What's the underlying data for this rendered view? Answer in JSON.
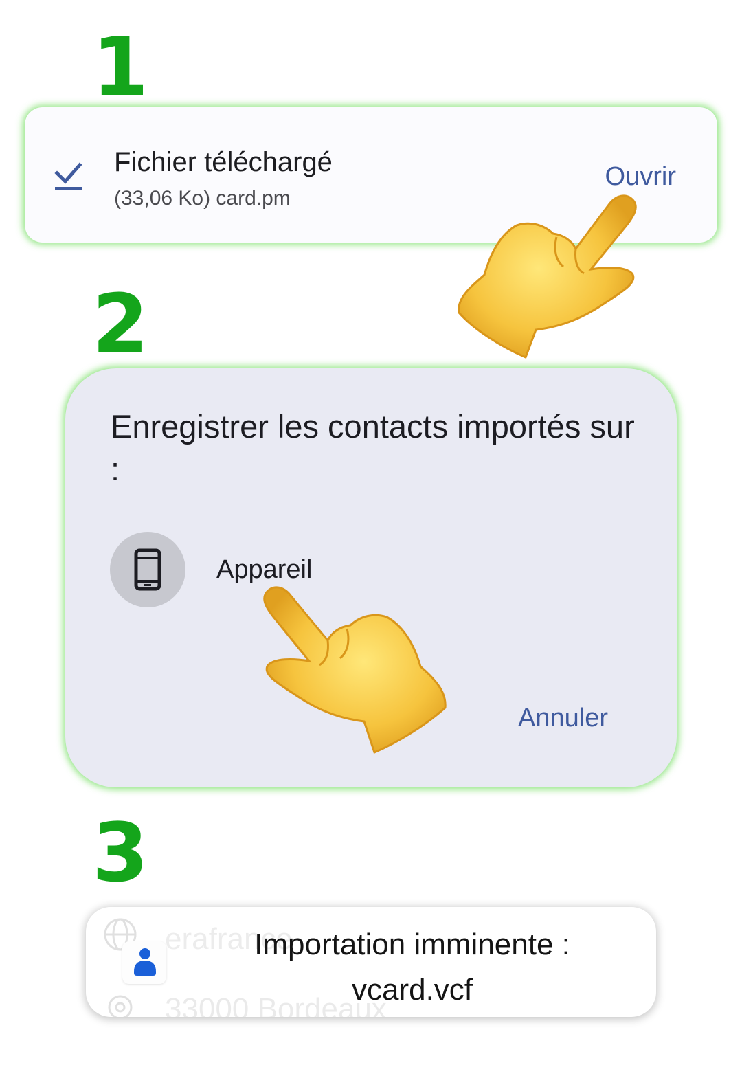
{
  "steps": {
    "one": "1",
    "two": "2",
    "three": "3"
  },
  "download_notification": {
    "icon": "download-done-icon",
    "title": "Fichier téléchargé",
    "subtitle": "(33,06 Ko) card.pm",
    "action_label": "Ouvrir"
  },
  "import_dialog": {
    "title": "Enregistrer les contacts importés sur :",
    "option_icon": "smartphone-icon",
    "option_label": "Appareil",
    "cancel_label": "Annuler"
  },
  "toast": {
    "icon": "contacts-app-icon",
    "line1": "Importation imminente :",
    "line2": "vcard.vcf",
    "background_text_1": "erafrance",
    "background_text_2": "33000 Bordeaux"
  },
  "colors": {
    "step_number": "#14a51b",
    "accent": "#3f5a9e",
    "glow": "#6edc5a"
  }
}
